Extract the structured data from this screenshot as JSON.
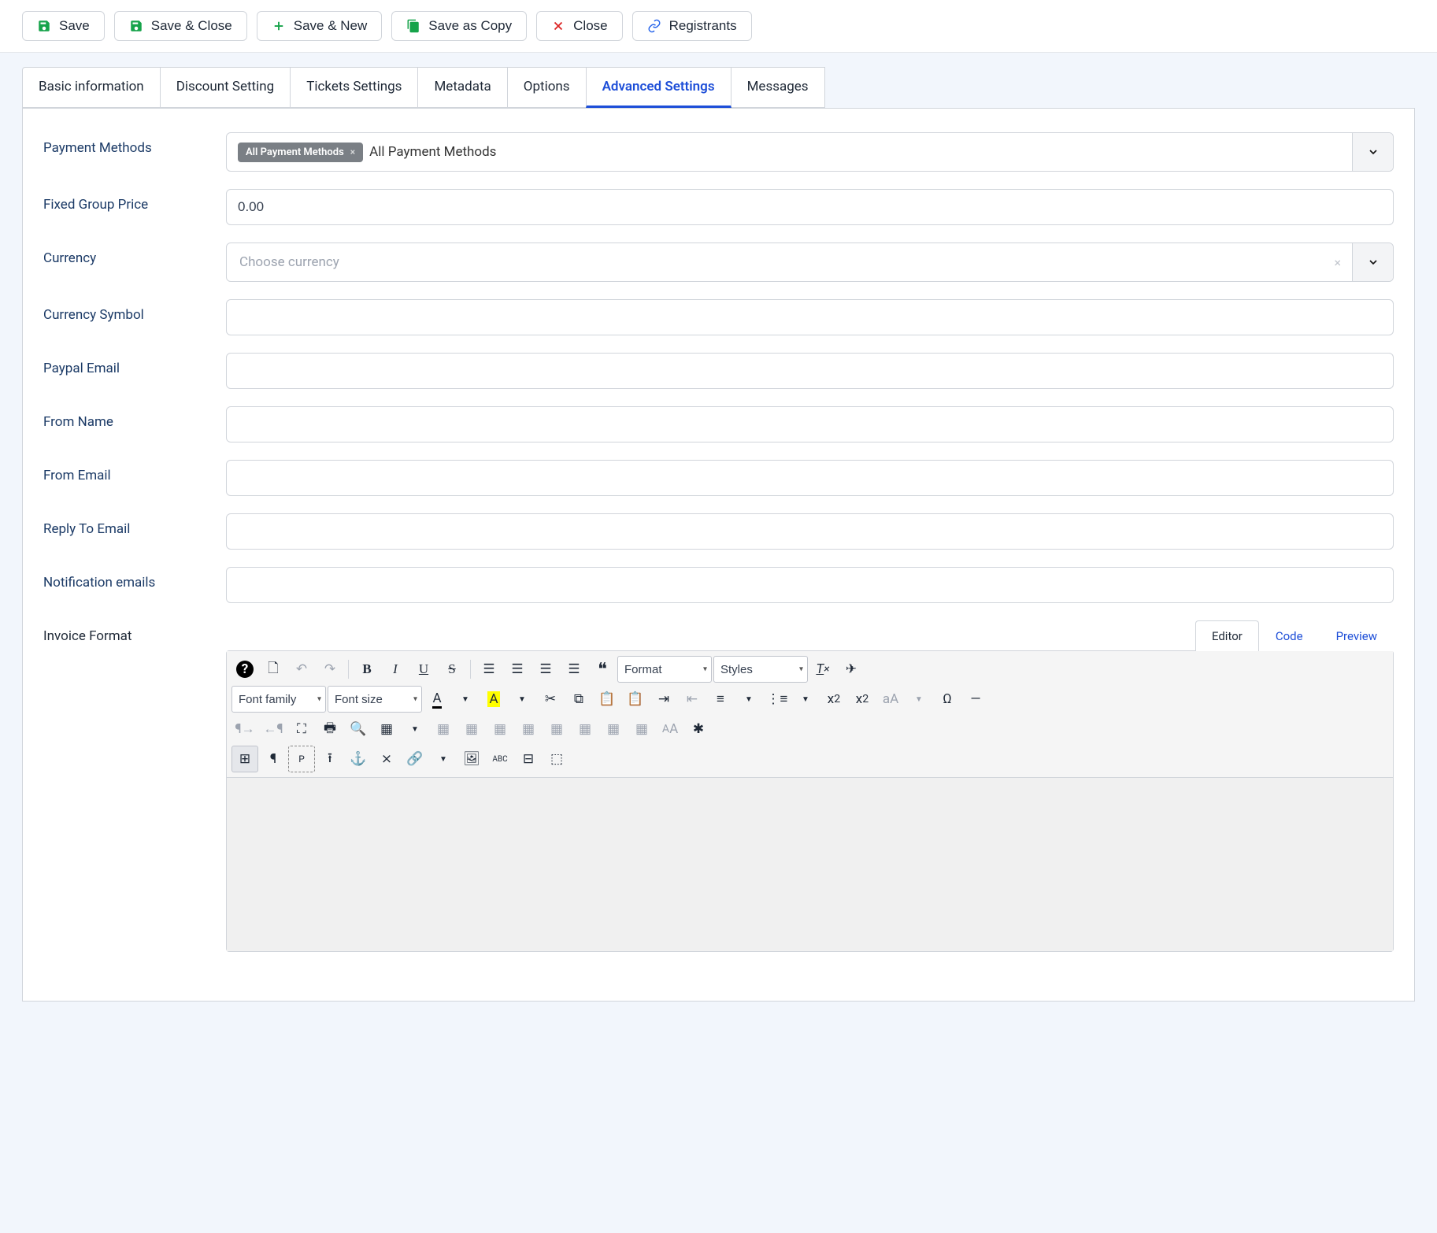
{
  "toolbar": {
    "save": "Save",
    "save_close": "Save & Close",
    "save_new": "Save & New",
    "save_copy": "Save as Copy",
    "close": "Close",
    "registrants": "Registrants"
  },
  "tabs": {
    "basic": "Basic information",
    "discount": "Discount Setting",
    "tickets": "Tickets Settings",
    "metadata": "Metadata",
    "options": "Options",
    "advanced": "Advanced Settings",
    "messages": "Messages"
  },
  "form": {
    "payment_methods_label": "Payment Methods",
    "payment_methods_chip": "All Payment Methods",
    "payment_methods_text": "All Payment Methods",
    "fixed_group_price_label": "Fixed Group Price",
    "fixed_group_price_value": "0.00",
    "currency_label": "Currency",
    "currency_placeholder": "Choose currency",
    "currency_symbol_label": "Currency Symbol",
    "currency_symbol_value": "",
    "paypal_email_label": "Paypal Email",
    "paypal_email_value": "",
    "from_name_label": "From Name",
    "from_name_value": "",
    "from_email_label": "From Email",
    "from_email_value": "",
    "reply_to_label": "Reply To Email",
    "reply_to_value": "",
    "notification_emails_label": "Notification emails",
    "notification_emails_value": "",
    "invoice_format_label": "Invoice Format"
  },
  "editor": {
    "tabs": {
      "editor": "Editor",
      "code": "Code",
      "preview": "Preview"
    },
    "format_sel": "Format",
    "styles_sel": "Styles",
    "font_family_sel": "Font family",
    "font_size_sel": "Font size"
  }
}
